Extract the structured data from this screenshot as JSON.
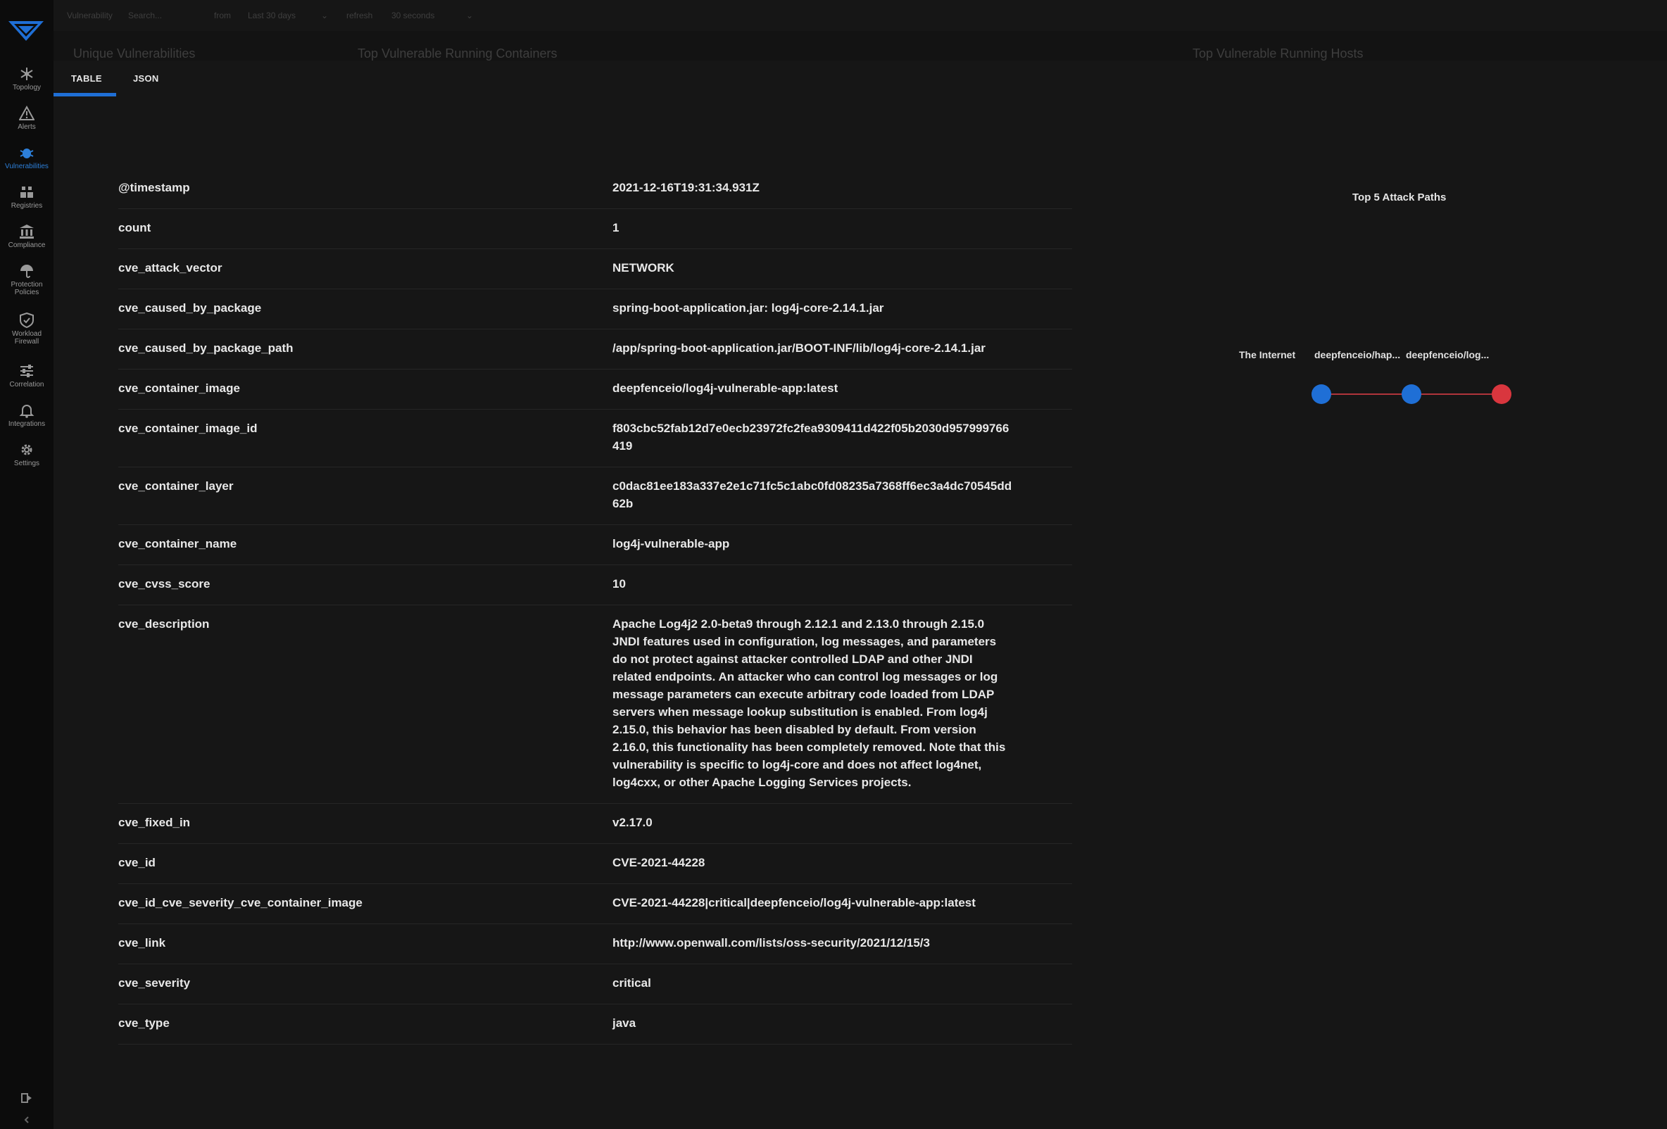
{
  "nav": {
    "items": [
      {
        "label": "Topology",
        "icon": "topology-icon"
      },
      {
        "label": "Alerts",
        "icon": "alert-icon"
      },
      {
        "label": "Vulnerabilities",
        "icon": "bug-icon",
        "active": true
      },
      {
        "label": "Registries",
        "icon": "registries-icon"
      },
      {
        "label": "Compliance",
        "icon": "bank-icon"
      },
      {
        "label": "Protection Policies",
        "icon": "umbrella-icon"
      },
      {
        "label": "Workload Firewall",
        "icon": "shield-icon"
      },
      {
        "label": "Correlation",
        "icon": "sliders-icon"
      },
      {
        "label": "Integrations",
        "icon": "bell-icon"
      },
      {
        "label": "Settings",
        "icon": "gear-icon"
      }
    ]
  },
  "topbar": {
    "filter_label": "Vulnerability",
    "search_placeholder": "Search...",
    "from_label": "from",
    "range_value": "Last 30 days",
    "refresh_label": "refresh",
    "refresh_value": "30 seconds"
  },
  "dashboard": {
    "unique_title": "Unique Vulnerabilities",
    "containers_title": "Top Vulnerable Running Containers",
    "hosts_title": "Top Vulnerable Running Hosts"
  },
  "tabs": {
    "table": "TABLE",
    "json": "JSON"
  },
  "table": {
    "rows": [
      {
        "key": "@timestamp",
        "value": "2021-12-16T19:31:34.931Z"
      },
      {
        "key": "count",
        "value": "1"
      },
      {
        "key": "cve_attack_vector",
        "value": "NETWORK"
      },
      {
        "key": "cve_caused_by_package",
        "value": "spring-boot-application.jar: log4j-core-2.14.1.jar"
      },
      {
        "key": "cve_caused_by_package_path",
        "value": "/app/spring-boot-application.jar/BOOT-INF/lib/log4j-core-2.14.1.jar"
      },
      {
        "key": "cve_container_image",
        "value": "deepfenceio/log4j-vulnerable-app:latest"
      },
      {
        "key": "cve_container_image_id",
        "value": "f803cbc52fab12d7e0ecb23972fc2fea9309411d422f05b2030d957999766419"
      },
      {
        "key": "cve_container_layer",
        "value": "c0dac81ee183a337e2e1c71fc5c1abc0fd08235a7368ff6ec3a4dc70545dd62b"
      },
      {
        "key": "cve_container_name",
        "value": "log4j-vulnerable-app"
      },
      {
        "key": "cve_cvss_score",
        "value": "10"
      },
      {
        "key": "cve_description",
        "value": "Apache Log4j2 2.0-beta9 through 2.12.1 and 2.13.0 through 2.15.0 JNDI features used in configuration, log messages, and parameters do not protect against attacker controlled LDAP and other JNDI related endpoints. An attacker who can control log messages or log message parameters can execute arbitrary code loaded from LDAP servers when message lookup substitution is enabled. From log4j 2.15.0, this behavior has been disabled by default. From version 2.16.0, this functionality has been completely removed. Note that this vulnerability is specific to log4j-core and does not affect log4net, log4cxx, or other Apache Logging Services projects.",
        "wrap": true
      },
      {
        "key": "cve_fixed_in",
        "value": "v2.17.0"
      },
      {
        "key": "cve_id",
        "value": "CVE-2021-44228"
      },
      {
        "key": "cve_id_cve_severity_cve_container_image",
        "value": "CVE-2021-44228|critical|deepfenceio/log4j-vulnerable-app:latest"
      },
      {
        "key": "cve_link",
        "value": "http://www.openwall.com/lists/oss-security/2021/12/15/3"
      },
      {
        "key": "cve_severity",
        "value": "critical"
      },
      {
        "key": "cve_type",
        "value": "java"
      }
    ]
  },
  "attack_paths": {
    "title": "Top 5 Attack Paths",
    "nodes": [
      {
        "label": "The Internet",
        "color": "#1f6fd6"
      },
      {
        "label": "deepfenceio/hap...",
        "color": "#1f6fd6"
      },
      {
        "label": "deepfenceio/log...",
        "color": "#d9363e"
      }
    ],
    "edge_color": "#b0353b"
  }
}
